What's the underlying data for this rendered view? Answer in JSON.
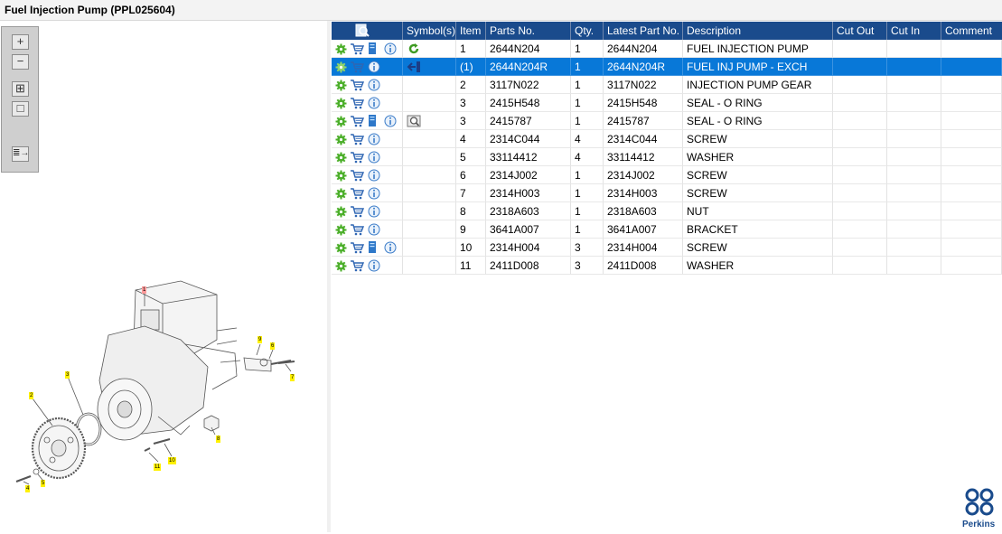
{
  "window": {
    "title": "Fuel Injection Pump (PPL025604)"
  },
  "toolbar": {
    "zoom_in": "+",
    "zoom_out": "−",
    "fit_all": "⊞",
    "fit_window": "□",
    "list_toggle": "≣→"
  },
  "diagram": {
    "callouts": [
      "1",
      "2",
      "3",
      "4",
      "5",
      "6",
      "7",
      "8",
      "9",
      "10",
      "11"
    ]
  },
  "grid": {
    "headers": [
      "Symbol(s)",
      "Item",
      "Parts No.",
      "Qty.",
      "Latest Part No.",
      "Description",
      "Cut Out",
      "Cut In",
      "Comment"
    ],
    "rows": [
      {
        "item": "1",
        "part": "2644N204",
        "qty": "1",
        "latest": "2644N204",
        "desc": "FUEL INJECTION PUMP",
        "cutout": "",
        "cutin": "",
        "comment": ""
      },
      {
        "item": "(1)",
        "part": "2644N204R",
        "qty": "1",
        "latest": "2644N204R",
        "desc": "FUEL INJ PUMP - EXCH",
        "cutout": "",
        "cutin": "",
        "comment": ""
      },
      {
        "item": "2",
        "part": "3117N022",
        "qty": "1",
        "latest": "3117N022",
        "desc": "INJECTION PUMP GEAR",
        "cutout": "",
        "cutin": "",
        "comment": ""
      },
      {
        "item": "3",
        "part": "2415H548",
        "qty": "1",
        "latest": "2415H548",
        "desc": "SEAL - O RING",
        "cutout": "",
        "cutin": "",
        "comment": ""
      },
      {
        "item": "3",
        "part": "2415787",
        "qty": "1",
        "latest": "2415787",
        "desc": "SEAL - O RING",
        "cutout": "",
        "cutin": "",
        "comment": ""
      },
      {
        "item": "4",
        "part": "2314C044",
        "qty": "4",
        "latest": "2314C044",
        "desc": "SCREW",
        "cutout": "",
        "cutin": "",
        "comment": ""
      },
      {
        "item": "5",
        "part": "33114412",
        "qty": "4",
        "latest": "33114412",
        "desc": "WASHER",
        "cutout": "",
        "cutin": "",
        "comment": ""
      },
      {
        "item": "6",
        "part": "2314J002",
        "qty": "1",
        "latest": "2314J002",
        "desc": "SCREW",
        "cutout": "",
        "cutin": "",
        "comment": ""
      },
      {
        "item": "7",
        "part": "2314H003",
        "qty": "1",
        "latest": "2314H003",
        "desc": "SCREW",
        "cutout": "",
        "cutin": "",
        "comment": ""
      },
      {
        "item": "8",
        "part": "2318A603",
        "qty": "1",
        "latest": "2318A603",
        "desc": "NUT",
        "cutout": "",
        "cutin": "",
        "comment": ""
      },
      {
        "item": "9",
        "part": "3641A007",
        "qty": "1",
        "latest": "3641A007",
        "desc": "BRACKET",
        "cutout": "",
        "cutin": "",
        "comment": ""
      },
      {
        "item": "10",
        "part": "2314H004",
        "qty": "3",
        "latest": "2314H004",
        "desc": "SCREW",
        "cutout": "",
        "cutin": "",
        "comment": ""
      },
      {
        "item": "11",
        "part": "2411D008",
        "qty": "3",
        "latest": "2411D008",
        "desc": "WASHER",
        "cutout": "",
        "cutin": "",
        "comment": ""
      }
    ]
  },
  "logo": {
    "text": "Perkins"
  },
  "colors": {
    "header": "#1a4b8c",
    "selection": "#0878d8",
    "gear": "#4caf2a"
  },
  "icons": {
    "header": "search-list-icon",
    "row": [
      "gear-icon",
      "cart-icon",
      "document-icon",
      "info-icon"
    ],
    "symbols": [
      "refresh-arrow-icon",
      "exchange-arrow-icon",
      "magnifier-icon"
    ]
  }
}
